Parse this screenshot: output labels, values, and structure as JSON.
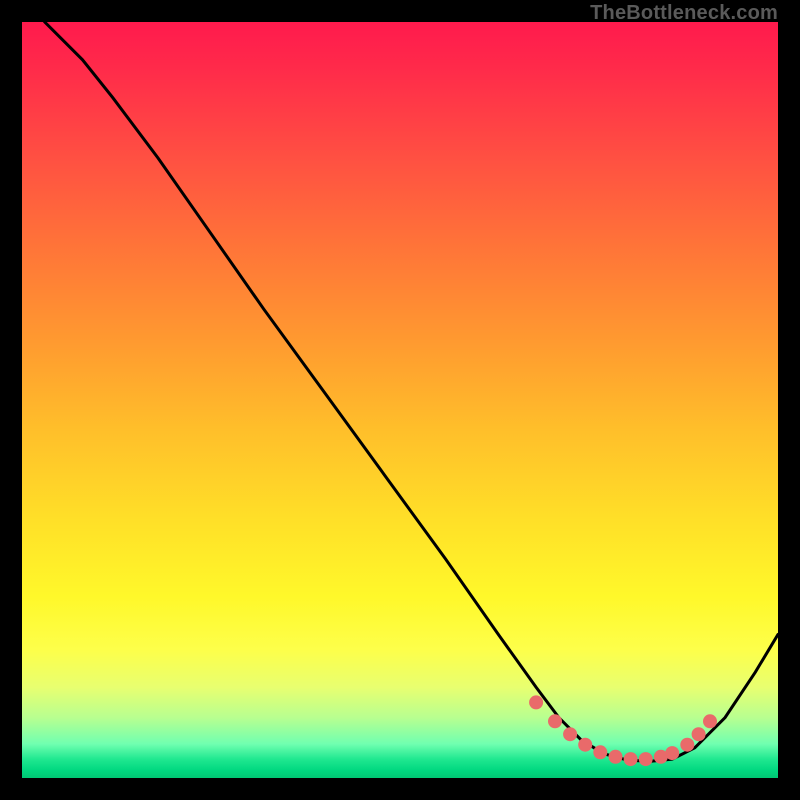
{
  "watermark": "TheBottleneck.com",
  "chart_data": {
    "type": "line",
    "title": "",
    "xlabel": "",
    "ylabel": "",
    "xlim": [
      0,
      100
    ],
    "ylim": [
      0,
      100
    ],
    "series": [
      {
        "name": "bottleneck-curve",
        "x": [
          3,
          8,
          12,
          18,
          25,
          32,
          40,
          48,
          56,
          63,
          68,
          71,
          74,
          77,
          80,
          83,
          86,
          89,
          93,
          97,
          100
        ],
        "values": [
          100,
          95,
          90,
          82,
          72,
          62,
          51,
          40,
          29,
          19,
          12,
          8,
          5,
          3.2,
          2.4,
          2.2,
          2.5,
          4,
          8,
          14,
          19
        ]
      }
    ],
    "highlight": {
      "name": "optimal-zone",
      "x": [
        68,
        70.5,
        72.5,
        74.5,
        76.5,
        78.5,
        80.5,
        82.5,
        84.5,
        86,
        88,
        89.5,
        91
      ],
      "values": [
        10,
        7.5,
        5.8,
        4.4,
        3.4,
        2.8,
        2.5,
        2.5,
        2.8,
        3.3,
        4.4,
        5.8,
        7.5
      ]
    },
    "colors": {
      "curve": "#000000",
      "highlight": "#e96a6a",
      "gradient_top": "#ff1a4d",
      "gradient_mid": "#ffe028",
      "gradient_bottom": "#00d880"
    }
  }
}
